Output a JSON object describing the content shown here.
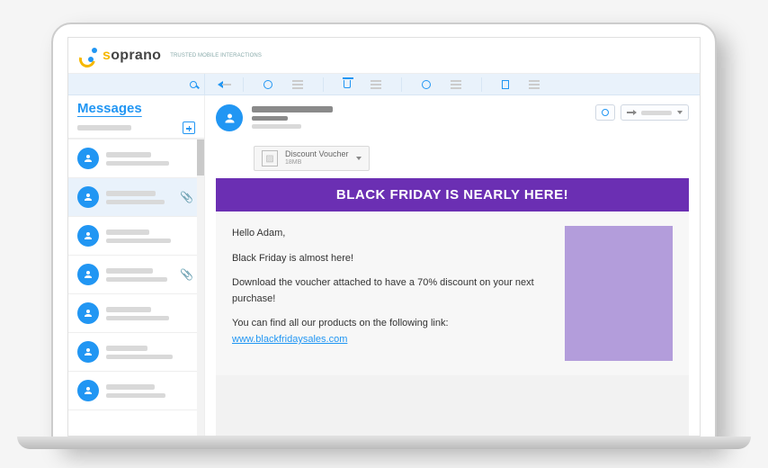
{
  "brand": {
    "name": "soprano",
    "tagline": "TRUSTED MOBILE INTERACTIONS"
  },
  "sidebar": {
    "title": "Messages",
    "items": [
      {
        "attachment": false,
        "selected": false
      },
      {
        "attachment": true,
        "selected": true
      },
      {
        "attachment": false,
        "selected": false
      },
      {
        "attachment": true,
        "selected": false
      },
      {
        "attachment": false,
        "selected": false
      },
      {
        "attachment": false,
        "selected": false
      },
      {
        "attachment": false,
        "selected": false
      }
    ]
  },
  "attachment": {
    "name": "Discount Voucher",
    "size": "18MB"
  },
  "email": {
    "banner": "BLACK FRIDAY IS NEARLY HERE!",
    "greeting": "Hello Adam,",
    "line1": "Black Friday is almost here!",
    "line2": "Download the voucher attached to have a 70% discount on your next purchase!",
    "line3": "You can find all our products on the following link:",
    "link": "www.blackfridaysales.com"
  }
}
